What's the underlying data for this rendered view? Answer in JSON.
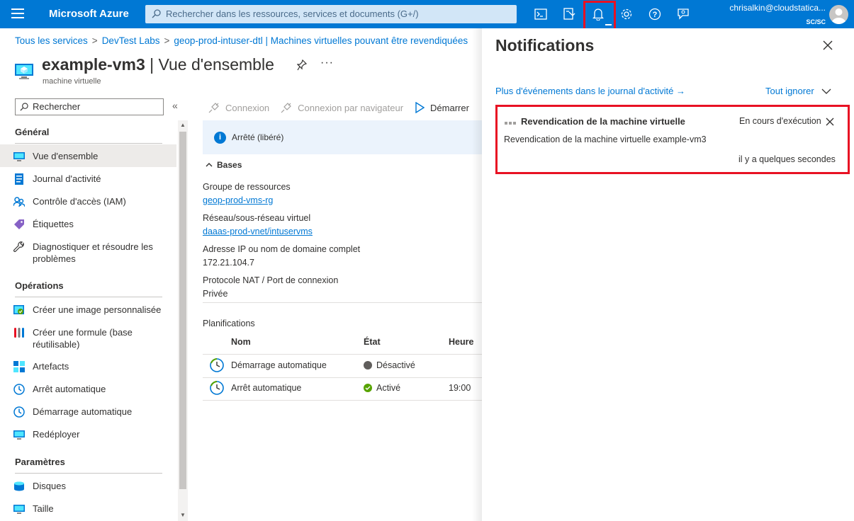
{
  "topbar": {
    "brand": "Microsoft Azure",
    "search_placeholder": "Rechercher dans les ressources, services et documents (G+/)",
    "account_email": "chrisalkin@cloudstatica...",
    "account_directory": "SC/SC",
    "icons": [
      "cloud-shell-icon",
      "directory-filter-icon",
      "bell-icon",
      "gear-icon",
      "help-icon",
      "feedback-icon"
    ]
  },
  "breadcrumb": [
    "Tous les services",
    "DevTest Labs",
    "geop-prod-intuser-dtl | Machines virtuelles pouvant être revendiquées"
  ],
  "page": {
    "title_bold": "example-vm3",
    "title_rest": " | Vue d'ensemble",
    "subtitle": "machine virtuelle",
    "more": "···"
  },
  "sidebar": {
    "search_placeholder": "Rechercher",
    "collapse": "«",
    "sections": [
      {
        "title": "Général",
        "items": [
          {
            "label": "Vue d'ensemble",
            "icon": "overview-icon"
          },
          {
            "label": "Journal d'activité",
            "icon": "activity-log-icon"
          },
          {
            "label": "Contrôle d'accès (IAM)",
            "icon": "iam-icon"
          },
          {
            "label": "Étiquettes",
            "icon": "tag-icon"
          },
          {
            "label": "Diagnostiquer et résoudre les problèmes",
            "icon": "wrench-icon"
          }
        ]
      },
      {
        "title": "Opérations",
        "items": [
          {
            "label": "Créer une image personnalisée",
            "icon": "custom-image-icon"
          },
          {
            "label": "Créer une formule (base réutilisable)",
            "icon": "formula-icon"
          },
          {
            "label": "Artefacts",
            "icon": "artifacts-icon"
          },
          {
            "label": "Arrêt automatique",
            "icon": "clock-icon"
          },
          {
            "label": "Démarrage automatique",
            "icon": "clock-icon"
          },
          {
            "label": "Redéployer",
            "icon": "redeploy-icon"
          }
        ]
      },
      {
        "title": "Paramètres",
        "items": [
          {
            "label": "Disques",
            "icon": "disk-icon"
          },
          {
            "label": "Taille",
            "icon": "size-icon"
          }
        ]
      }
    ]
  },
  "toolbar": {
    "connect": "Connexion",
    "browser_connect": "Connexion par navigateur",
    "start": "Démarrer"
  },
  "status_banner": "Arrêté (libéré)",
  "essentials": {
    "header": "Bases",
    "resource_group_label": "Groupe de ressources",
    "resource_group_value": "geop-prod-vms-rg",
    "vnet_label": "Réseau/sous-réseau virtuel",
    "vnet_value": "daaas-prod-vnet/intuservms",
    "ip_label": "Adresse IP ou nom de domaine complet",
    "ip_value": "172.21.104.7",
    "nat_label": "Protocole NAT / Port de connexion",
    "nat_value": "Privée"
  },
  "schedules": {
    "title": "Planifications",
    "columns": [
      "Nom",
      "État",
      "Heure"
    ],
    "rows": [
      {
        "name": "Démarrage automatique",
        "state": "Désactivé",
        "state_color": "#605e5c",
        "time": ""
      },
      {
        "name": "Arrêt automatique",
        "state": "Activé",
        "state_color": "#57a300",
        "time": "19:00"
      }
    ]
  },
  "notifications": {
    "title": "Notifications",
    "more_events": "Plus d'événements dans le journal d'activité →",
    "dismiss_all": "Tout ignorer",
    "card": {
      "title": "Revendication de la machine virtuelle",
      "status": "En cours d'exécution",
      "description": "Revendication de la machine virtuelle example-vm3",
      "time": "il y a quelques secondes"
    }
  },
  "colors": {
    "accent": "#0078d4",
    "highlight": "#e81123"
  }
}
